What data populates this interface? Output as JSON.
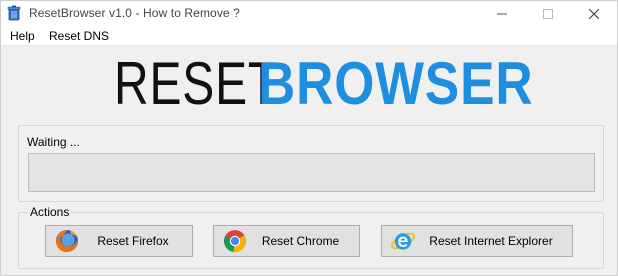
{
  "window": {
    "title": "ResetBrowser v1.0 - How to Remove ?",
    "controls": {
      "minimize": "—",
      "maximize": "☐",
      "close": "✕"
    }
  },
  "menu": {
    "items": [
      {
        "label": "Help"
      },
      {
        "label": "Reset DNS"
      }
    ]
  },
  "logo": {
    "part1": "RESET",
    "part2": "BROWSER",
    "colors": {
      "part1": "#111111",
      "part2": "#1e8ee0"
    }
  },
  "status": {
    "text": "Waiting ...",
    "progress": 0
  },
  "actions": {
    "group_label": "Actions",
    "buttons": [
      {
        "label": "Reset Firefox",
        "icon": "firefox-icon"
      },
      {
        "label": "Reset Chrome",
        "icon": "chrome-icon"
      },
      {
        "label": "Reset Internet Explorer",
        "icon": "internet-explorer-icon"
      }
    ]
  },
  "colors": {
    "window_bg": "#f0f0f0",
    "button_bg": "#e1e1e1",
    "progress_bg": "#e4e4e4",
    "progress_fill": "#06b025"
  }
}
